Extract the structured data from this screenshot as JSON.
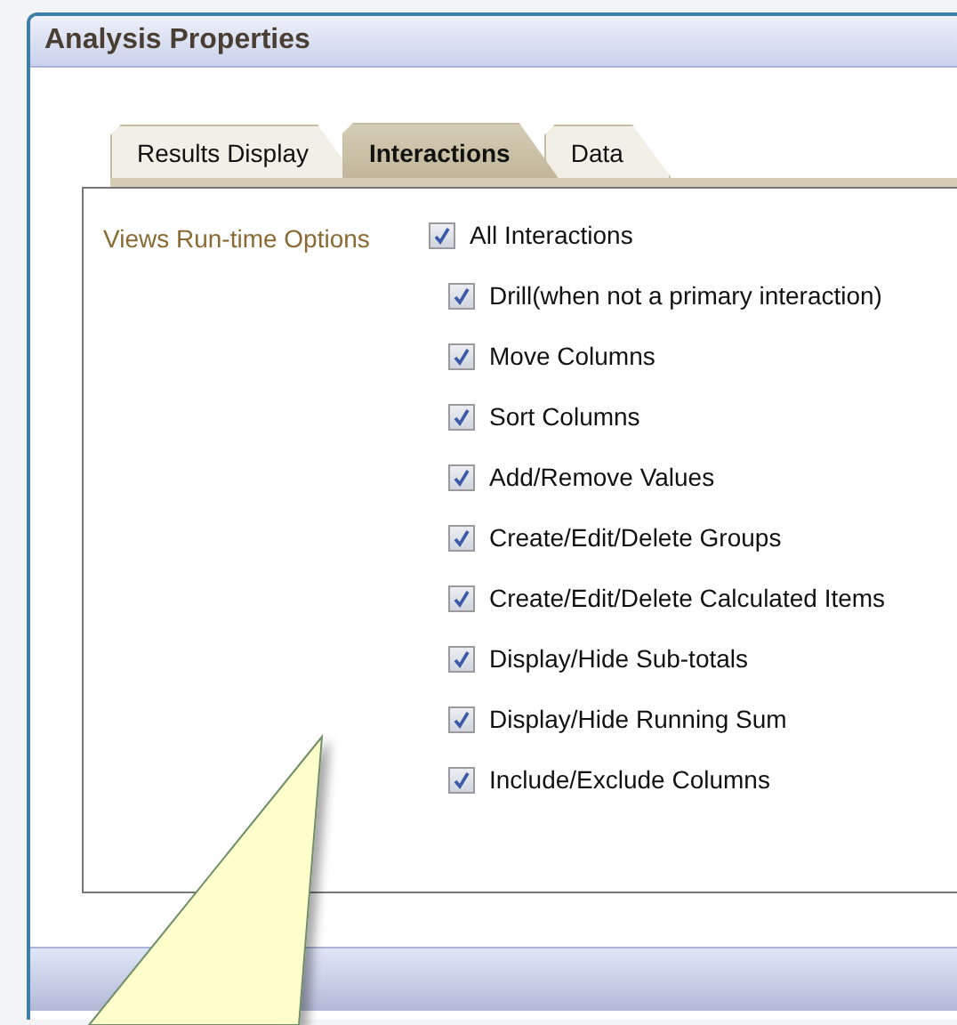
{
  "window": {
    "title": "Analysis Properties"
  },
  "tabs": [
    {
      "label": "Results Display",
      "selected": false
    },
    {
      "label": "Interactions",
      "selected": true
    },
    {
      "label": "Data",
      "selected": false
    }
  ],
  "section_label": "Views Run-time Options",
  "options": [
    {
      "label": "All Interactions",
      "checked": true,
      "children": [
        {
          "label": "Drill(when not a primary interaction)",
          "checked": true
        },
        {
          "label": "Move Columns",
          "checked": true
        },
        {
          "label": "Sort Columns",
          "checked": true
        },
        {
          "label": "Add/Remove Values",
          "checked": true
        },
        {
          "label": "Create/Edit/Delete Groups",
          "checked": true
        },
        {
          "label": "Create/Edit/Delete Calculated Items",
          "checked": true
        },
        {
          "label": "Display/Hide Sub-totals",
          "checked": true
        },
        {
          "label": "Display/Hide Running Sum",
          "checked": true
        },
        {
          "label": "Include/Exclude Columns",
          "checked": true
        }
      ]
    }
  ]
}
